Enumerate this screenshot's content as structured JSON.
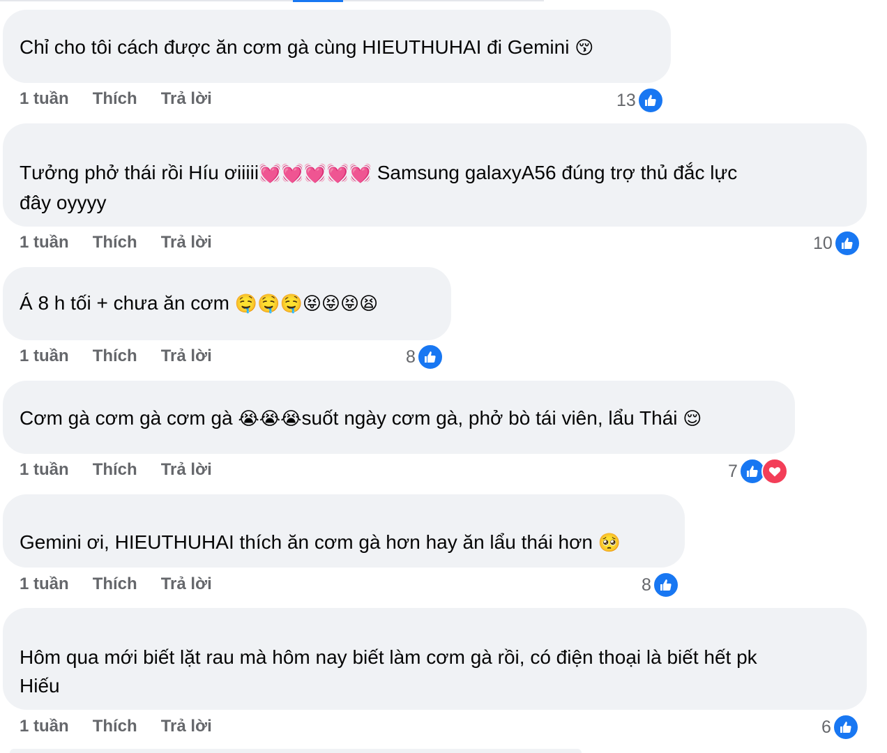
{
  "comments": [
    {
      "text": "Chỉ cho tôi cách được ăn cơm gà cùng HIEUTHUHAI đi Gemini",
      "emoji": "😚",
      "time": "1 tuần",
      "like_label": "Thích",
      "reply_label": "Trả lời",
      "reaction_count": "13",
      "reactions": [
        "like-icon"
      ]
    },
    {
      "text": "Tưởng phở thái rồi Híu ơiiiii",
      "emoji": "💓💓💓💓💓",
      "text2": " Samsung galaxyA56 đúng trợ thủ đắc lực",
      "text3": "đây oyyyy",
      "time": "1 tuần",
      "like_label": "Thích",
      "reply_label": "Trả lời",
      "reaction_count": "10",
      "reactions": [
        "like-icon"
      ]
    },
    {
      "text": "Á 8 h tối + chưa ăn cơm",
      "emoji": "🤤🤤🤤😝😝😝😫",
      "time": "1 tuần",
      "like_label": "Thích",
      "reply_label": "Trả lời",
      "reaction_count": "8",
      "reactions": [
        "like-icon"
      ]
    },
    {
      "text": "Cơm gà cơm gà cơm gà",
      "emoji": "😭😭😭",
      "text2": "suốt ngày cơm gà, phở bò tái viên, lẩu Thái",
      "emoji2": "😌",
      "time": "1 tuần",
      "like_label": "Thích",
      "reply_label": "Trả lời",
      "reaction_count": "7",
      "reactions": [
        "like-icon",
        "love-icon"
      ]
    },
    {
      "text": "Gemini ơi, HIEUTHUHAI thích ăn cơm gà hơn hay ăn lẩu thái hơn",
      "emoji": "🥺",
      "time": "1 tuần",
      "like_label": "Thích",
      "reply_label": "Trả lời",
      "reaction_count": "8",
      "reactions": [
        "like-icon"
      ]
    },
    {
      "text": "Hôm qua mới biết lặt rau mà hôm nay biết làm cơm gà rồi, có điện thoại là biết hết pk",
      "text3": "Hiếu",
      "time": "1 tuần",
      "like_label": "Thích",
      "reply_label": "Trả lời",
      "reaction_count": "6",
      "reactions": [
        "like-icon"
      ]
    }
  ],
  "colors": {
    "bubble": "#f0f2f5",
    "meta_text": "#65676b",
    "like_blue": "#1877f2",
    "love_red": "#f33e58"
  }
}
